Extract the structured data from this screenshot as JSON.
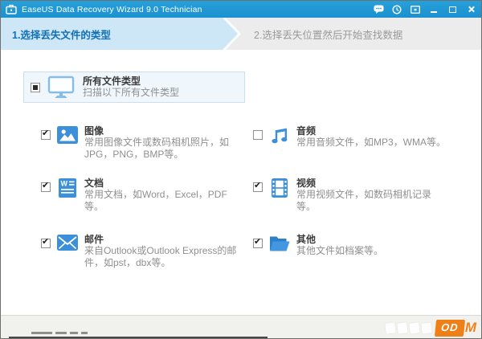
{
  "window": {
    "title": "EaseUS Data Recovery Wizard 9.0 Technician"
  },
  "steps": [
    {
      "label": "1.选择丢失文件的类型",
      "active": true
    },
    {
      "label": "2.选择丢失位置然后开始查找数据",
      "active": false
    }
  ],
  "all_types": {
    "title": "所有文件类型",
    "description": "扫描以下所有文件类型",
    "checked": "indeterminate"
  },
  "file_types": [
    {
      "title": "图像",
      "description": "常用图像文件或数码相机照片，如JPG，PNG，BMP等。",
      "checked": true,
      "icon": "image-icon"
    },
    {
      "title": "音频",
      "description": "常用音频文件，如MP3，WMA等。",
      "checked": false,
      "icon": "audio-icon"
    },
    {
      "title": "文档",
      "description": "常用文档，如Word，Excel，PDF等。",
      "checked": true,
      "icon": "document-icon"
    },
    {
      "title": "视频",
      "description": "常用视频文件，如数码相机记录等。",
      "checked": true,
      "icon": "video-icon"
    },
    {
      "title": "邮件",
      "description": "来自Outlook或Outlook Express的邮件，如pst，dbx等。",
      "checked": true,
      "icon": "email-icon"
    },
    {
      "title": "其他",
      "description": "其他文件如档案等。",
      "checked": true,
      "icon": "folder-icon"
    }
  ],
  "titlebar_icons": [
    "chat-icon",
    "history-icon",
    "window-capture-icon",
    "minimize-icon",
    "maximize-icon",
    "close-icon"
  ],
  "watermark": {
    "badge": "OD",
    "suffix": "M"
  },
  "colors": {
    "titlebar": "#1f98d5",
    "accent_blue": "#3c8fd9",
    "monitor_blue": "#85bce8",
    "step_active_bg": "#cee7f7",
    "step_active_text": "#1170b4",
    "step_inactive_bg": "#ececec",
    "step_inactive_text": "#9a9a9a",
    "watermark_orange": "#ef8018"
  }
}
